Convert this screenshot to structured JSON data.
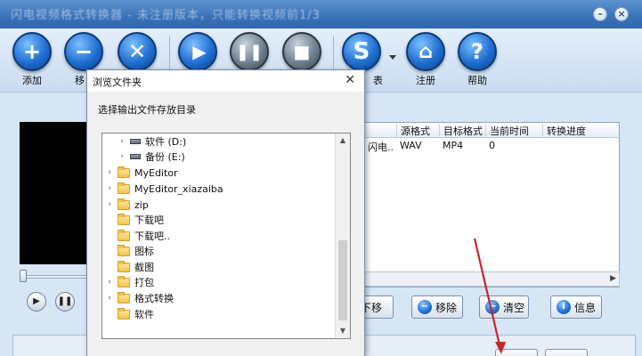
{
  "window": {
    "title": "闪电视频格式转换器 - 未注册版本，只能转换视频前1/3"
  },
  "toolbar": {
    "items": [
      {
        "label": "添加",
        "icon": "plus-icon"
      },
      {
        "label": "移除",
        "icon": "minus-icon"
      },
      {
        "label": "",
        "icon": "x-icon"
      },
      {
        "label": "",
        "icon": "play-icon"
      },
      {
        "label": "",
        "icon": "pause-icon"
      },
      {
        "label": "",
        "icon": "stop-icon"
      },
      {
        "label": "",
        "icon": "s-logo-icon"
      },
      {
        "label": "注册",
        "icon": "home-icon"
      },
      {
        "label": "帮助",
        "icon": "question-icon"
      }
    ],
    "partial_label": "移",
    "partial_label2": "表"
  },
  "table": {
    "columns": [
      "源格式",
      "目标格式",
      "当前时间",
      "转换进度"
    ],
    "rows": [
      {
        "name": "闪电..",
        "source": "WAV",
        "target": "MP4",
        "time": "0",
        "progress": ""
      }
    ]
  },
  "actions": {
    "down_label": "下移",
    "remove_label": "移除",
    "clear_label": "清空",
    "info_label": "信息"
  },
  "dialog": {
    "title": "浏览文件夹",
    "prompt": "选择输出文件存放目录",
    "tree": [
      {
        "label": "软件 (D:)",
        "type": "drive",
        "indent": 1,
        "expandable": true
      },
      {
        "label": "备份 (E:)",
        "type": "drive",
        "indent": 1,
        "expandable": true
      },
      {
        "label": "MyEditor",
        "type": "folder",
        "indent": 0,
        "expandable": true
      },
      {
        "label": "MyEditor_xiazaiba",
        "type": "folder",
        "indent": 0,
        "expandable": true
      },
      {
        "label": "zip",
        "type": "folder",
        "indent": 0,
        "expandable": true
      },
      {
        "label": "下载吧",
        "type": "folder",
        "indent": 0,
        "expandable": false
      },
      {
        "label": "下载吧..",
        "type": "folder",
        "indent": 0,
        "expandable": false
      },
      {
        "label": "图标",
        "type": "folder",
        "indent": 0,
        "expandable": false
      },
      {
        "label": "截图",
        "type": "folder",
        "indent": 0,
        "expandable": false
      },
      {
        "label": "打包",
        "type": "folder",
        "indent": 0,
        "expandable": true
      },
      {
        "label": "格式转换",
        "type": "folder",
        "indent": 0,
        "expandable": true
      },
      {
        "label": "软件",
        "type": "folder",
        "indent": 0,
        "expandable": false
      }
    ]
  },
  "colors": {
    "titlebar": "#3a72b8",
    "toolbar_icon": "#1f6fd1",
    "annotation_arrow": "#c62828"
  }
}
